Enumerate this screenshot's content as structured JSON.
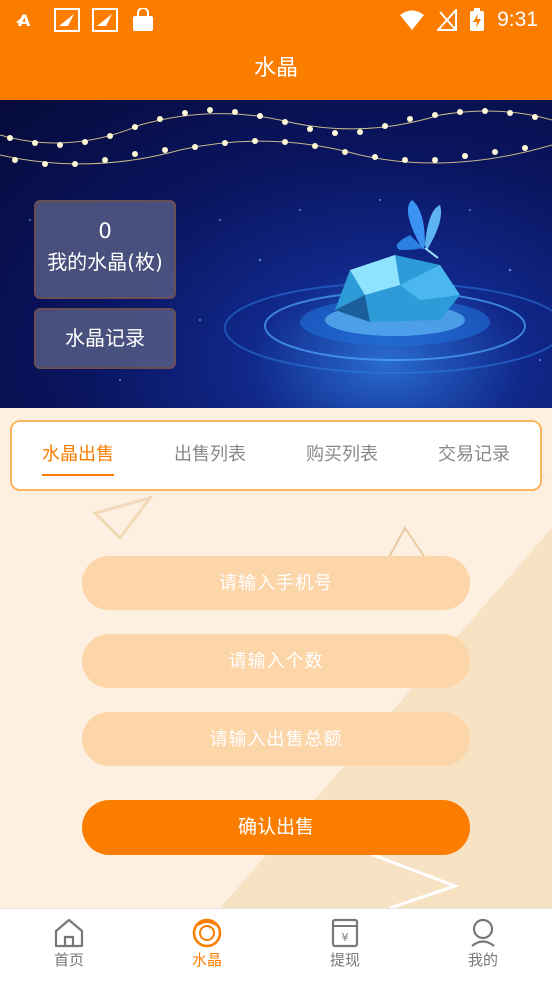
{
  "status_bar": {
    "time": "9:31",
    "icons_left": [
      "font-app-icon",
      "bird-app-icon",
      "bird-app-icon",
      "shopping-bag-icon"
    ],
    "icons_right": [
      "wifi-icon",
      "no-signal-icon",
      "battery-charging-icon"
    ]
  },
  "header": {
    "title": "水晶"
  },
  "banner": {
    "crystal_count": "0",
    "crystal_label": "我的水晶(枚)",
    "record_label": "水晶记录"
  },
  "tabs": [
    {
      "label": "水晶出售",
      "active": true
    },
    {
      "label": "出售列表",
      "active": false
    },
    {
      "label": "购买列表",
      "active": false
    },
    {
      "label": "交易记录",
      "active": false
    }
  ],
  "form": {
    "phone_placeholder": "请输入手机号",
    "quantity_placeholder": "请输入个数",
    "total_placeholder": "请输入出售总额",
    "confirm_label": "确认出售"
  },
  "bottom_nav": [
    {
      "label": "首页",
      "icon": "home-icon",
      "active": false
    },
    {
      "label": "水晶",
      "icon": "crystal-icon",
      "active": true
    },
    {
      "label": "提现",
      "icon": "withdraw-icon",
      "active": false
    },
    {
      "label": "我的",
      "icon": "profile-icon",
      "active": false
    }
  ],
  "colors": {
    "accent": "#fb7d00",
    "input_bg": "#fcd5a8",
    "content_bg": "#fdf0e0"
  }
}
